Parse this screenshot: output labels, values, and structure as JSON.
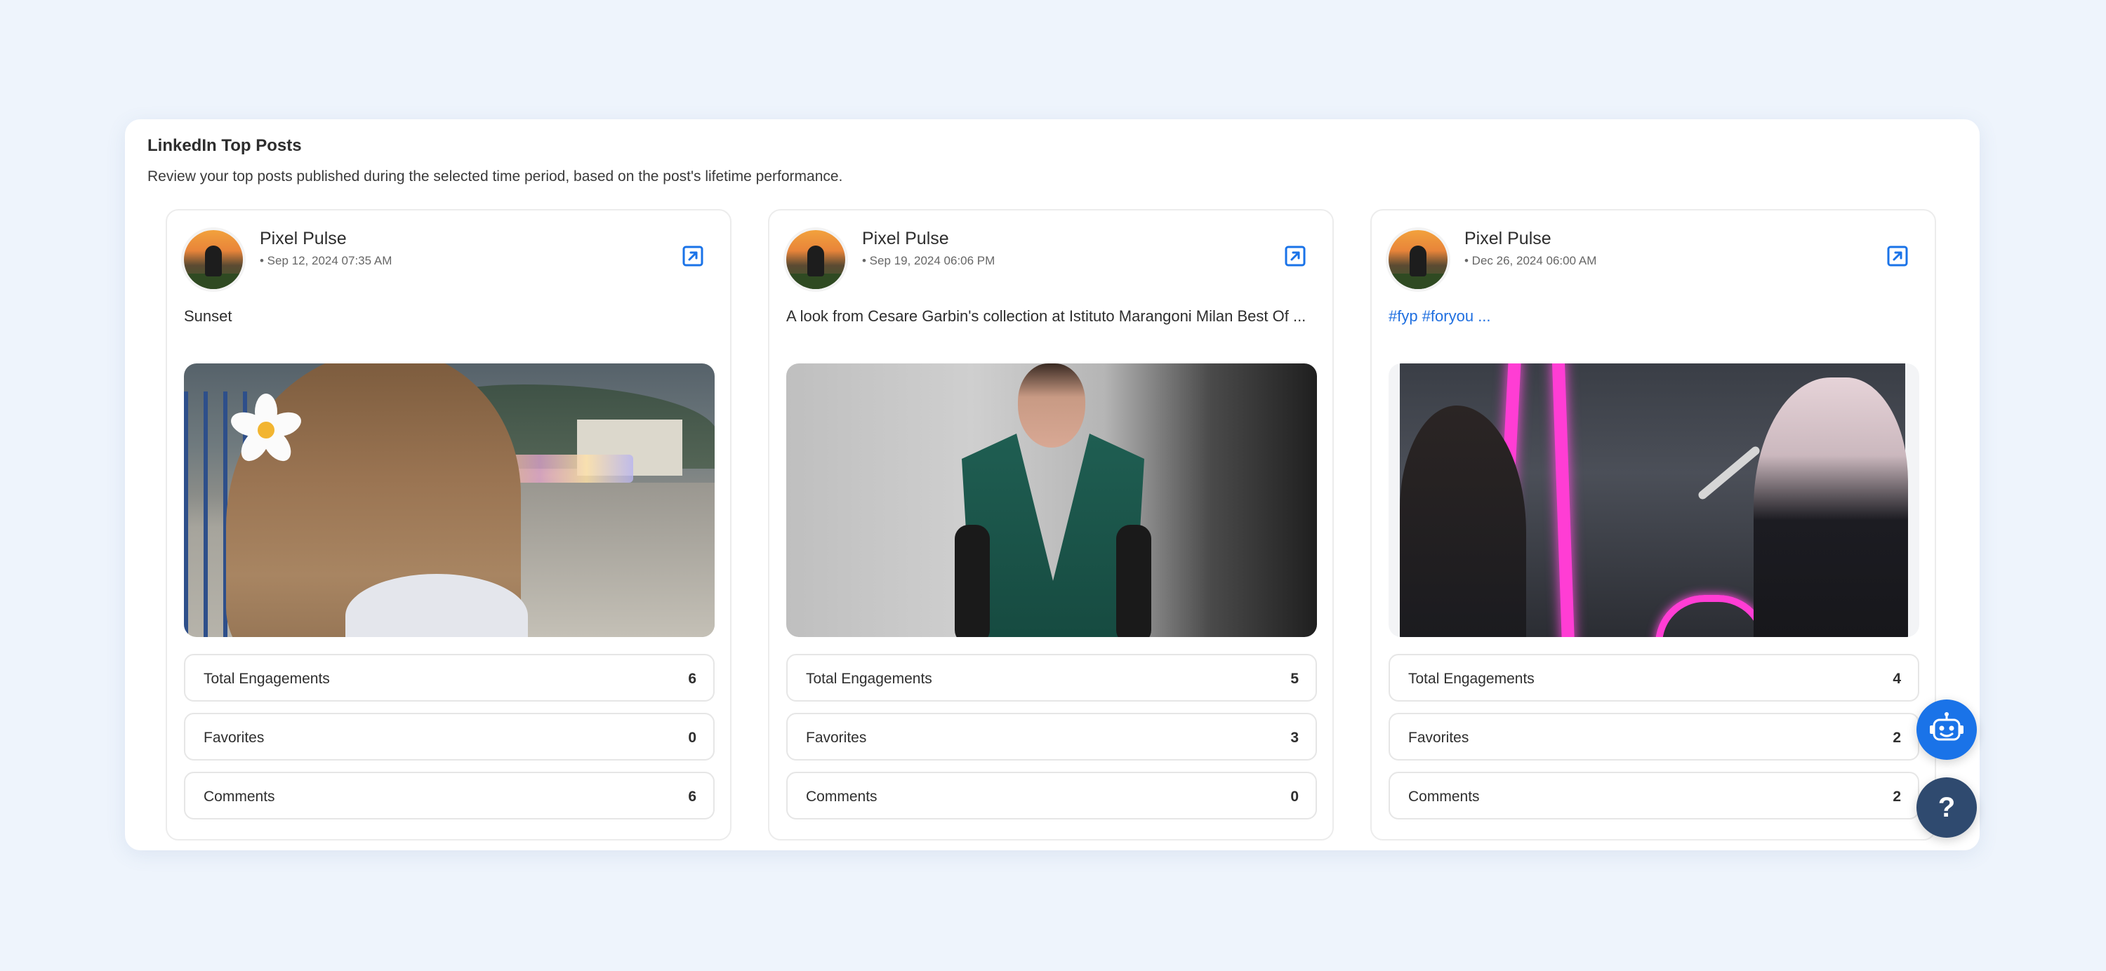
{
  "panel": {
    "title": "LinkedIn Top Posts",
    "subtitle": "Review your top posts published during the selected time period, based on the post's lifetime performance."
  },
  "colors": {
    "accent": "#1a73e8",
    "help_button": "#2f4a6f",
    "link_text": "#1f6fe0"
  },
  "posts": [
    {
      "author": "Pixel Pulse",
      "date": "• Sep 12, 2024 07:35 AM",
      "caption": "Sunset",
      "stats": [
        {
          "label": "Total Engagements",
          "value": "6"
        },
        {
          "label": "Favorites",
          "value": "0"
        },
        {
          "label": "Comments",
          "value": "6"
        }
      ]
    },
    {
      "author": "Pixel Pulse",
      "date": "• Sep 19, 2024 06:06 PM",
      "caption": "A look from Cesare Garbin's collection at Istituto Marangoni Milan Best Of ...",
      "stats": [
        {
          "label": "Total Engagements",
          "value": "5"
        },
        {
          "label": "Favorites",
          "value": "3"
        },
        {
          "label": "Comments",
          "value": "0"
        }
      ]
    },
    {
      "author": "Pixel Pulse",
      "date": "• Dec 26, 2024 06:00 AM",
      "caption": "#fyp #foryou ...",
      "stats": [
        {
          "label": "Total Engagements",
          "value": "4"
        },
        {
          "label": "Favorites",
          "value": "2"
        },
        {
          "label": "Comments",
          "value": "2"
        }
      ]
    }
  ],
  "icons": {
    "external_link": "external-link-icon",
    "chatbot": "robot-icon",
    "help": "question-icon"
  },
  "help_button": {
    "glyph": "?"
  }
}
